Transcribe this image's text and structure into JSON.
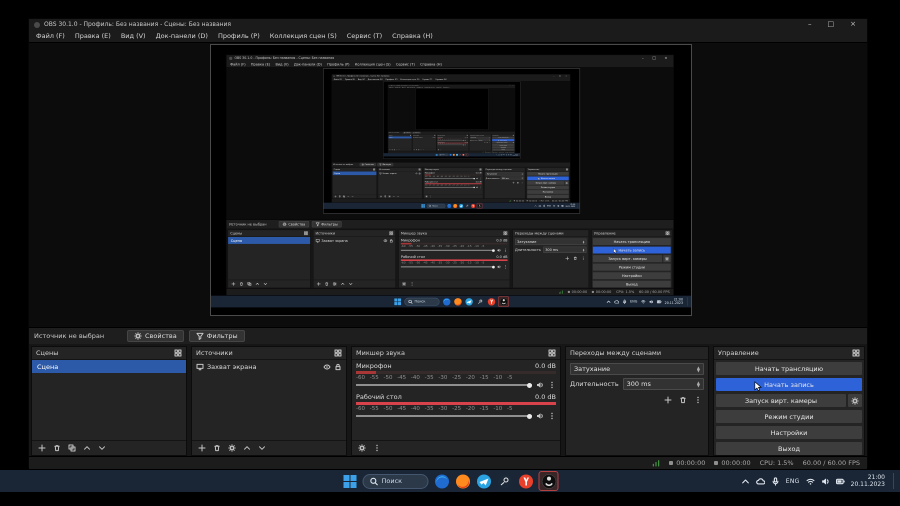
{
  "window": {
    "title": "OBS 30.1.0 - Профиль: Без названия - Сцены: Без названия",
    "minimize": "–",
    "maximize": "□",
    "close": "×"
  },
  "menu": {
    "items": [
      "Файл (F)",
      "Правка (E)",
      "Вид (V)",
      "Док-панели (D)",
      "Профиль (P)",
      "Коллекция сцен (S)",
      "Сервис (T)",
      "Справка (H)"
    ]
  },
  "source_toolbar": {
    "status": "Источник не выбран",
    "properties_label": "Свойства",
    "filters_label": "Фильтры"
  },
  "scenes": {
    "title": "Сцены",
    "items": [
      "Сцена"
    ]
  },
  "sources": {
    "title": "Источники",
    "items": [
      "Захват экрана"
    ]
  },
  "mixer": {
    "title": "Микшер звука",
    "ticks": "-60 -55 -50 -45 -40 -35 -30 -25 -20 -15 -10 -5",
    "channels": [
      {
        "name": "Микрофон",
        "level": "0.0 dB"
      },
      {
        "name": "Рабочий стол",
        "level": "0.0 dB"
      }
    ]
  },
  "transitions": {
    "title": "Переходы между сценами",
    "selected": "Затухание",
    "duration_label": "Длительность",
    "duration_value": "300 ms"
  },
  "controls": {
    "title": "Управление",
    "stream": "Начать трансляцию",
    "record": "Начать запись",
    "virtual_camera": "Запуск вирт. камеры",
    "studio_mode": "Режим студии",
    "settings": "Настройки",
    "exit": "Выход"
  },
  "status": {
    "stream_time": "00:00:00",
    "rec_time": "00:00:00",
    "cpu": "CPU: 1.5%",
    "fps": "60.00 / 60.00 FPS"
  },
  "taskbar": {
    "search": "Поиск",
    "language": "ENG",
    "time": "21:00",
    "date": "20.11.2023"
  },
  "icons": {
    "properties": "gear",
    "filters": "funnel",
    "visibility": "eye",
    "lock": "padlock",
    "mute": "speaker",
    "search": "magnifier",
    "add": "plus",
    "remove": "trash"
  },
  "colors": {
    "selection": "#2d5aa8",
    "record_button": "#2e62d9",
    "meter_red": "#d8434b",
    "taskbar_bg": "#1a2636",
    "active_app_border": "#b64040"
  }
}
